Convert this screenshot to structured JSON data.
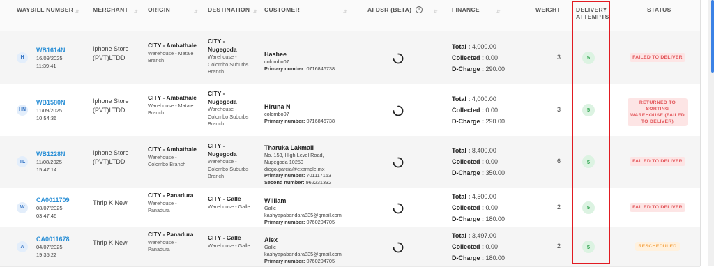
{
  "headers": {
    "waybill": "WAYBILL NUMBER",
    "merchant": "MERCHANT",
    "origin": "ORIGIN",
    "destination": "DESTINATION",
    "customer": "CUSTOMER",
    "ai_dsr": "AI DSR (BETA)",
    "finance": "FINANCE",
    "weight": "WEIGHT",
    "delivery_attempts_1": "DELIVERY",
    "delivery_attempts_2": "ATTEMPTS",
    "status": "STATUS",
    "info_glyph": "i"
  },
  "labels": {
    "total": "Total :",
    "collected": "Collected :",
    "dcharge": "D-Charge :"
  },
  "rows": [
    {
      "initials": "H",
      "id": "WB1614N",
      "date": "16/09/2025",
      "time": "11:39:41",
      "merchant": "Iphone Store (PVT)LTDD",
      "origin_city": "CITY - Ambathale",
      "origin_sub": "Warehouse - Matale Branch",
      "dest_city": "CITY - Nugegoda",
      "dest_sub": "Warehouse - Colombo Suburbs Branch",
      "cust_name": "Hashee",
      "cust_line1": "colombo07",
      "cust_line2": "",
      "primary_label": "Primary number:",
      "primary": "0716846738",
      "second_label": "",
      "second": "",
      "email": "",
      "total": "4,000.00",
      "collected": "0.00",
      "dcharge": "290.00",
      "weight": "3",
      "attempts": "5",
      "status": "FAILED TO DELIVER",
      "status_color": "#e2575b"
    },
    {
      "initials": "HN",
      "id": "WB1580N",
      "date": "11/09/2025",
      "time": "10:54:36",
      "merchant": "Iphone Store (PVT)LTDD",
      "origin_city": "CITY - Ambathale",
      "origin_sub": "Warehouse - Matale Branch",
      "dest_city": "CITY - Nugegoda",
      "dest_sub": "Warehouse - Colombo Suburbs Branch",
      "cust_name": "Hiruna N",
      "cust_line1": "colombo07",
      "cust_line2": "",
      "primary_label": "Primary number:",
      "primary": "0716846738",
      "second_label": "",
      "second": "",
      "email": "",
      "total": "4,000.00",
      "collected": "0.00",
      "dcharge": "290.00",
      "weight": "3",
      "attempts": "5",
      "status": "RETURNED TO SORTING WAREHOUSE (FAILED TO DELIVER)",
      "status_color": "#e2575b"
    },
    {
      "initials": "TL",
      "id": "WB1228N",
      "date": "11/08/2025",
      "time": "15:47:14",
      "merchant": "Iphone Store (PVT)LTDD",
      "origin_city": "CITY - Ambathale",
      "origin_sub": "Warehouse - Colombo Branch",
      "dest_city": "CITY - Nugegoda",
      "dest_sub": "Warehouse - Colombo Suburbs Branch",
      "cust_name": "Tharuka Lakmali",
      "cust_line1": "No. 153, High Level Road,",
      "cust_line2": "Nugegoda 10250",
      "email": "diego.garcia@example.mx",
      "primary_label": "Primary number:",
      "primary": "701117153",
      "second_label": "Second number:",
      "second": "962231332",
      "total": "8,400.00",
      "collected": "0.00",
      "dcharge": "350.00",
      "weight": "6",
      "attempts": "5",
      "status": "FAILED TO DELIVER",
      "status_color": "#e2575b"
    },
    {
      "initials": "W",
      "id": "CA0011709",
      "date": "08/07/2025",
      "time": "03:47:46",
      "merchant": "Thrip K New",
      "origin_city": "CITY - Panadura",
      "origin_sub": "Warehouse - Panadura",
      "dest_city": "CITY - Galle",
      "dest_sub": "Warehouse - Galle",
      "cust_name": "William",
      "cust_line1": "Galle",
      "cust_line2": "",
      "email": "kashyapabandara835@gmail.com",
      "primary_label": "Primary number:",
      "primary": "0760204705",
      "second_label": "",
      "second": "",
      "total": "4,500.00",
      "collected": "0.00",
      "dcharge": "180.00",
      "weight": "2",
      "attempts": "5",
      "status": "FAILED TO DELIVER",
      "status_color": "#e2575b"
    },
    {
      "initials": "A",
      "id": "CA0011678",
      "date": "04/07/2025",
      "time": "19:35:22",
      "merchant": "Thrip K New",
      "origin_city": "CITY - Panadura",
      "origin_sub": "Warehouse - Panadura",
      "dest_city": "CITY - Galle",
      "dest_sub": "Warehouse - Galle",
      "cust_name": "Alex",
      "cust_line1": "Galle",
      "cust_line2": "",
      "email": "kashyapabandara835@gmail.com",
      "primary_label": "Primary number:",
      "primary": "0760204705",
      "second_label": "",
      "second": "",
      "total": "3,497.00",
      "collected": "0.00",
      "dcharge": "180.00",
      "weight": "2",
      "attempts": "5",
      "status": "RESCHEDULED",
      "status_color": "#f3a347"
    }
  ]
}
